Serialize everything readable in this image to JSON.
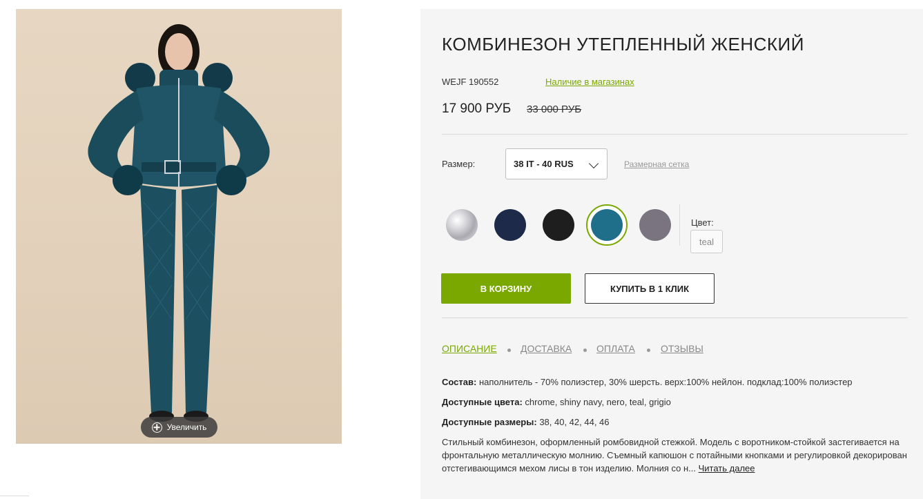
{
  "product": {
    "title": "КОМБИНЕЗОН УТЕПЛЕННЫЙ ЖЕНСКИЙ",
    "sku": "WEJF 190552",
    "availability_link": "Наличие в магазинах",
    "price": "17 900 РУБ",
    "old_price": "33 000 РУБ"
  },
  "photo": {
    "zoom_label": "Увеличить"
  },
  "size": {
    "label": "Размер:",
    "selected": "38 IT - 40 RUS",
    "grid_link": "Размерная сетка"
  },
  "colors": {
    "label": "Цвет:",
    "selected": "teal",
    "swatches": [
      {
        "name": "chrome",
        "color": "#c8c8cc"
      },
      {
        "name": "shiny navy",
        "color": "#1d2a4a"
      },
      {
        "name": "nero",
        "color": "#1e1e1e"
      },
      {
        "name": "teal",
        "color": "#1f6f8b"
      },
      {
        "name": "grigio",
        "color": "#7a7480"
      }
    ]
  },
  "actions": {
    "cart": "В КОРЗИНУ",
    "one_click": "КУПИТЬ В 1 КЛИК"
  },
  "tabs": [
    "ОПИСАНИЕ",
    "ДОСТАВКА",
    "ОПЛАТА",
    "ОТЗЫВЫ"
  ],
  "details": {
    "composition_label": "Состав:",
    "composition": "наполнитель - 70% полиэстер, 30% шерсть. верх:100% нейлон. подклад:100% полиэстер",
    "colors_label": "Доступные цвета:",
    "colors": "chrome, shiny navy, nero, teal, grigio",
    "sizes_label": "Доступные размеры:",
    "sizes": "38, 40, 42, 44, 46",
    "description": "Стильный комбинезон, оформленный ромбовидной стежкой. Модель с воротником-стойкой застегивается на фронтальную металлическую молнию. Съемный капюшон с потайными кнопками и регулировкой декорирован отстегивающимся мехом лисы в тон изделию. Молния со н...",
    "read_more": "Читать далее"
  },
  "theme": {
    "accent": "#7aa800",
    "panel_bg": "#f5f5f5"
  }
}
